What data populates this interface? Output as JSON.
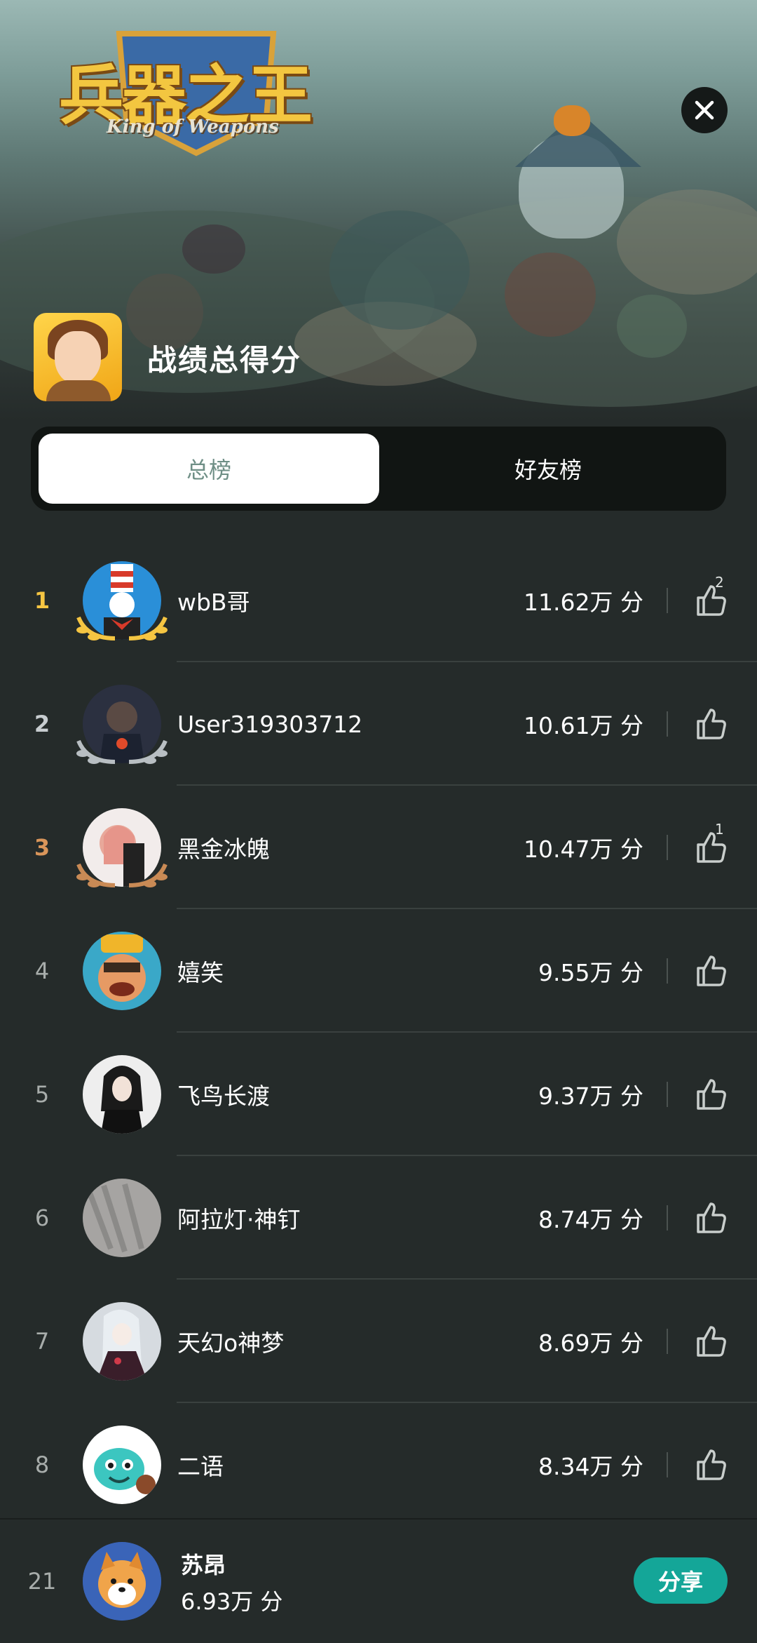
{
  "header": {
    "logo_title": "兵器之王",
    "logo_subtitle": "King of Weapons",
    "score_title": "战绩总得分",
    "close_icon": "close-icon"
  },
  "tabs": [
    {
      "label": "总榜",
      "active": true
    },
    {
      "label": "好友榜",
      "active": false
    }
  ],
  "leaderboard": [
    {
      "rank": "1",
      "name": "wbB哥",
      "score": "11.62万 分",
      "likes": "2",
      "avatar_color": "#2a8fd8"
    },
    {
      "rank": "2",
      "name": "User319303712",
      "score": "10.61万 分",
      "likes": "",
      "avatar_color": "#3b4150"
    },
    {
      "rank": "3",
      "name": "黑金冰魄",
      "score": "10.47万 分",
      "likes": "1",
      "avatar_color": "#e8d8d4"
    },
    {
      "rank": "4",
      "name": "嬉笑",
      "score": "9.55万 分",
      "likes": "",
      "avatar_color": "#d8763c"
    },
    {
      "rank": "5",
      "name": "飞鸟长渡",
      "score": "9.37万 分",
      "likes": "",
      "avatar_color": "#e9e9e9"
    },
    {
      "rank": "6",
      "name": "阿拉灯·神钉",
      "score": "8.74万 分",
      "likes": "",
      "avatar_color": "#9a9a9a"
    },
    {
      "rank": "7",
      "name": "天幻o神梦",
      "score": "8.69万 分",
      "likes": "",
      "avatar_color": "#c9cfd6"
    },
    {
      "rank": "8",
      "name": "二语",
      "score": "8.34万 分",
      "likes": "",
      "avatar_color": "#ffffff"
    }
  ],
  "my_rank": {
    "rank": "21",
    "name": "苏昂",
    "score": "6.93万 分",
    "share_label": "分享"
  },
  "colors": {
    "background": "#252b2a",
    "accent": "#14a698",
    "gold": "#f5c542",
    "bronze": "#d9955a"
  }
}
